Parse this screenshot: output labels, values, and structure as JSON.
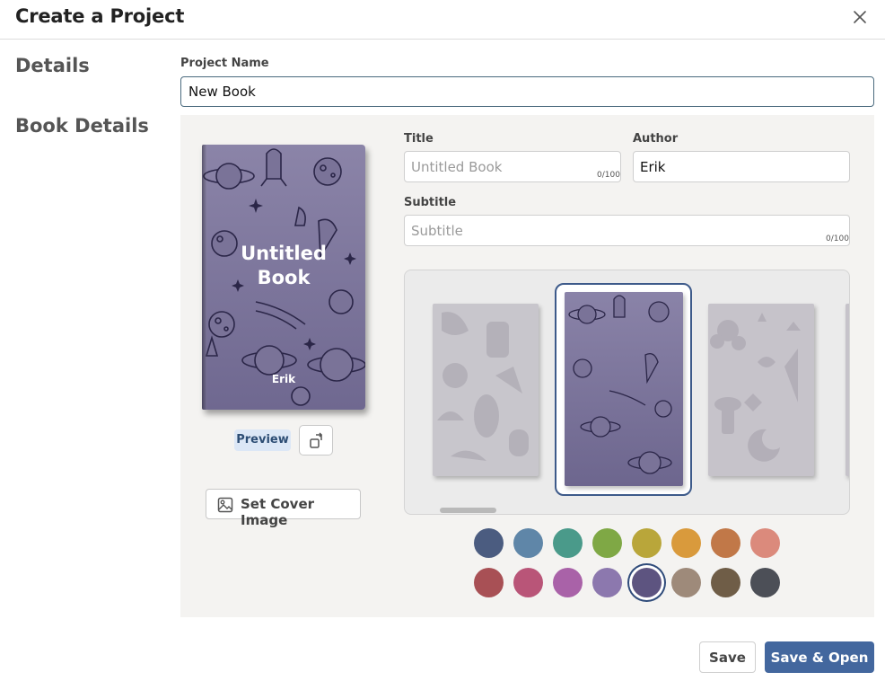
{
  "dialog": {
    "title": "Create a Project",
    "close_icon": "close-icon"
  },
  "nav": {
    "details": "Details",
    "book_details": "Book Details"
  },
  "project": {
    "label": "Project Name",
    "value": "New Book"
  },
  "book": {
    "title_label": "Title",
    "title_placeholder": "Untitled Book",
    "title_counter": "0/100",
    "author_label": "Author",
    "author_value": "Erik",
    "subtitle_label": "Subtitle",
    "subtitle_placeholder": "Subtitle",
    "subtitle_counter": "0/100"
  },
  "preview": {
    "cover_title": "Untitled Book",
    "cover_author": "Erik",
    "badge": "Preview",
    "rotate_icon": "rotate-icon",
    "set_cover_label": "Set Cover Image",
    "image_icon": "image-icon"
  },
  "templates": [
    {
      "name": "abstract-shapes",
      "selected": false
    },
    {
      "name": "space",
      "selected": true
    },
    {
      "name": "botanical",
      "selected": false
    }
  ],
  "colors": [
    "#4b5c80",
    "#5f86a8",
    "#4a9a8a",
    "#7fa845",
    "#b9a63a",
    "#d99a3c",
    "#c17848",
    "#db8a7c",
    "#a85055",
    "#b95578",
    "#a962a8",
    "#8c78ae",
    "#5d5480",
    "#9e8a7a",
    "#6f5d47",
    "#4c4f57"
  ],
  "selected_color": "#5d5480",
  "footer": {
    "save": "Save",
    "save_open": "Save & Open"
  }
}
